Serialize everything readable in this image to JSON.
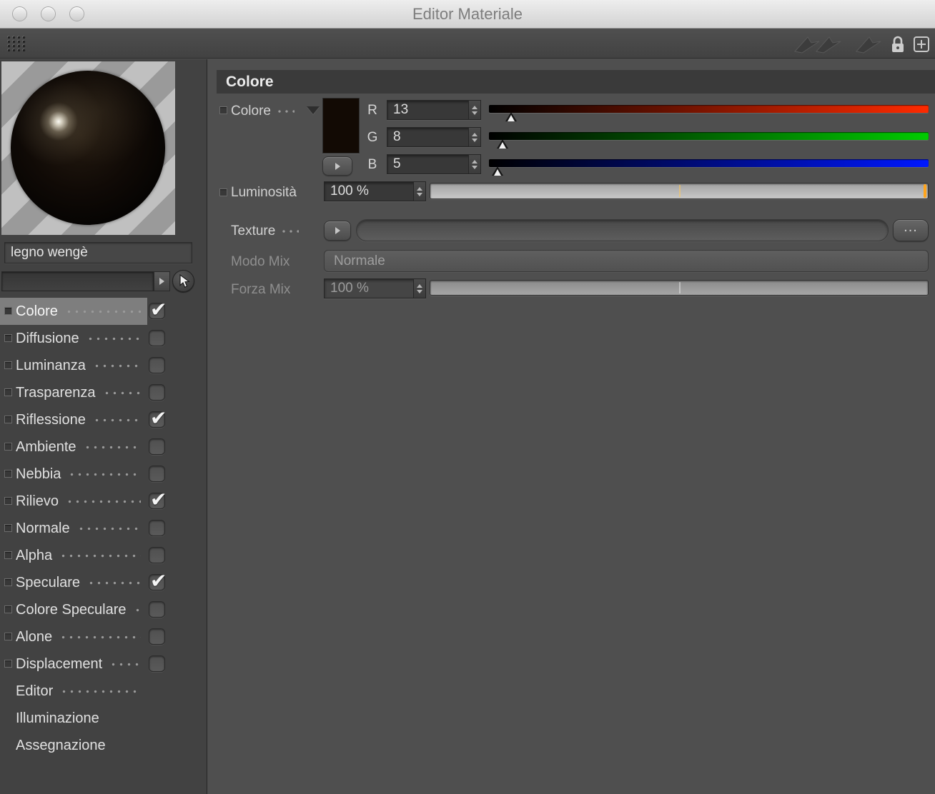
{
  "window": {
    "title": "Editor Materiale"
  },
  "sidebar": {
    "material_name": "legno wengè",
    "preview_field": "",
    "channels": [
      {
        "label": "Colore",
        "checkbox": true,
        "checked": true,
        "selected": true,
        "dots": true
      },
      {
        "label": "Diffusione",
        "checkbox": true,
        "checked": false,
        "selected": false,
        "dots": true
      },
      {
        "label": "Luminanza",
        "checkbox": true,
        "checked": false,
        "selected": false,
        "dots": true
      },
      {
        "label": "Trasparenza",
        "checkbox": true,
        "checked": false,
        "selected": false,
        "dots": true
      },
      {
        "label": "Riflessione",
        "checkbox": true,
        "checked": true,
        "selected": false,
        "dots": true
      },
      {
        "label": "Ambiente",
        "checkbox": true,
        "checked": false,
        "selected": false,
        "dots": true
      },
      {
        "label": "Nebbia",
        "checkbox": true,
        "checked": false,
        "selected": false,
        "dots": true
      },
      {
        "label": "Rilievo",
        "checkbox": true,
        "checked": true,
        "selected": false,
        "dots": true
      },
      {
        "label": "Normale",
        "checkbox": true,
        "checked": false,
        "selected": false,
        "dots": true
      },
      {
        "label": "Alpha",
        "checkbox": true,
        "checked": false,
        "selected": false,
        "dots": true
      },
      {
        "label": "Speculare",
        "checkbox": true,
        "checked": true,
        "selected": false,
        "dots": true
      },
      {
        "label": "Colore Speculare",
        "checkbox": true,
        "checked": false,
        "selected": false,
        "dots": true
      },
      {
        "label": "Alone",
        "checkbox": true,
        "checked": false,
        "selected": false,
        "dots": true
      },
      {
        "label": "Displacement",
        "checkbox": true,
        "checked": false,
        "selected": false,
        "dots": true
      },
      {
        "label": "Editor",
        "checkbox": false,
        "checked": false,
        "selected": false,
        "dots": true
      },
      {
        "label": "Illuminazione",
        "checkbox": false,
        "checked": false,
        "selected": false,
        "dots": false
      },
      {
        "label": "Assegnazione",
        "checkbox": false,
        "checked": false,
        "selected": false,
        "dots": false
      }
    ]
  },
  "panel": {
    "section_title": "Colore",
    "color_row": {
      "label": "Colore",
      "swatch_color": "#120a04",
      "channels": [
        {
          "key": "R",
          "value": 13,
          "max": 255,
          "display": "13",
          "gradient_end": "#ff2a00"
        },
        {
          "key": "G",
          "value": 8,
          "max": 255,
          "display": "8",
          "gradient_end": "#00cc00"
        },
        {
          "key": "B",
          "value": 5,
          "max": 255,
          "display": "5",
          "gradient_end": "#0018ff"
        }
      ]
    },
    "brightness_row": {
      "label": "Luminosità",
      "value": "100 %"
    },
    "texture_row": {
      "label": "Texture",
      "browse_label": "..."
    },
    "mix_mode_row": {
      "label": "Modo Mix",
      "value": "Normale"
    },
    "mix_strength_row": {
      "label": "Forza Mix",
      "value": "100 %"
    }
  },
  "colors": {
    "slider_indicator": "#ffa41c"
  }
}
